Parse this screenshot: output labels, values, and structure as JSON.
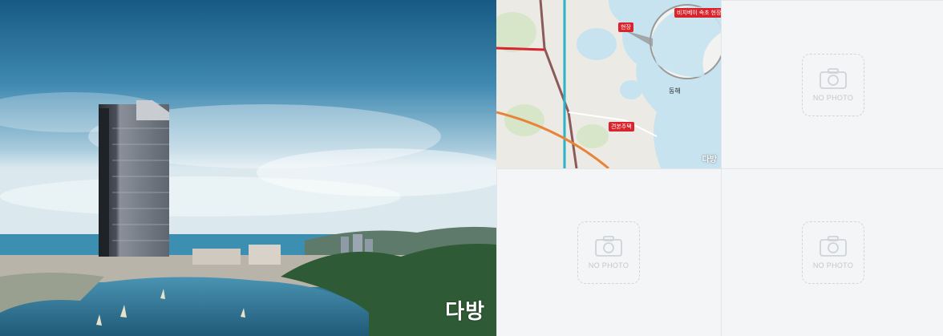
{
  "gallery": {
    "main_photo": {
      "watermark": "다방"
    },
    "map": {
      "sea_label": "동해",
      "site_tag": "현장",
      "model_house_tag": "견본주택",
      "inset_title": "비치베이 속초 현장",
      "watermark": "다방"
    },
    "placeholders": [
      {
        "label": "NO PHOTO"
      },
      {
        "label": "NO PHOTO"
      },
      {
        "label": "NO PHOTO"
      }
    ]
  },
  "colors": {
    "sea": "#c6e3ef",
    "land": "#eceae4",
    "tag": "#d9232d",
    "placeholder_bg": "#f4f5f7",
    "placeholder_text": "#c3c7cc"
  }
}
